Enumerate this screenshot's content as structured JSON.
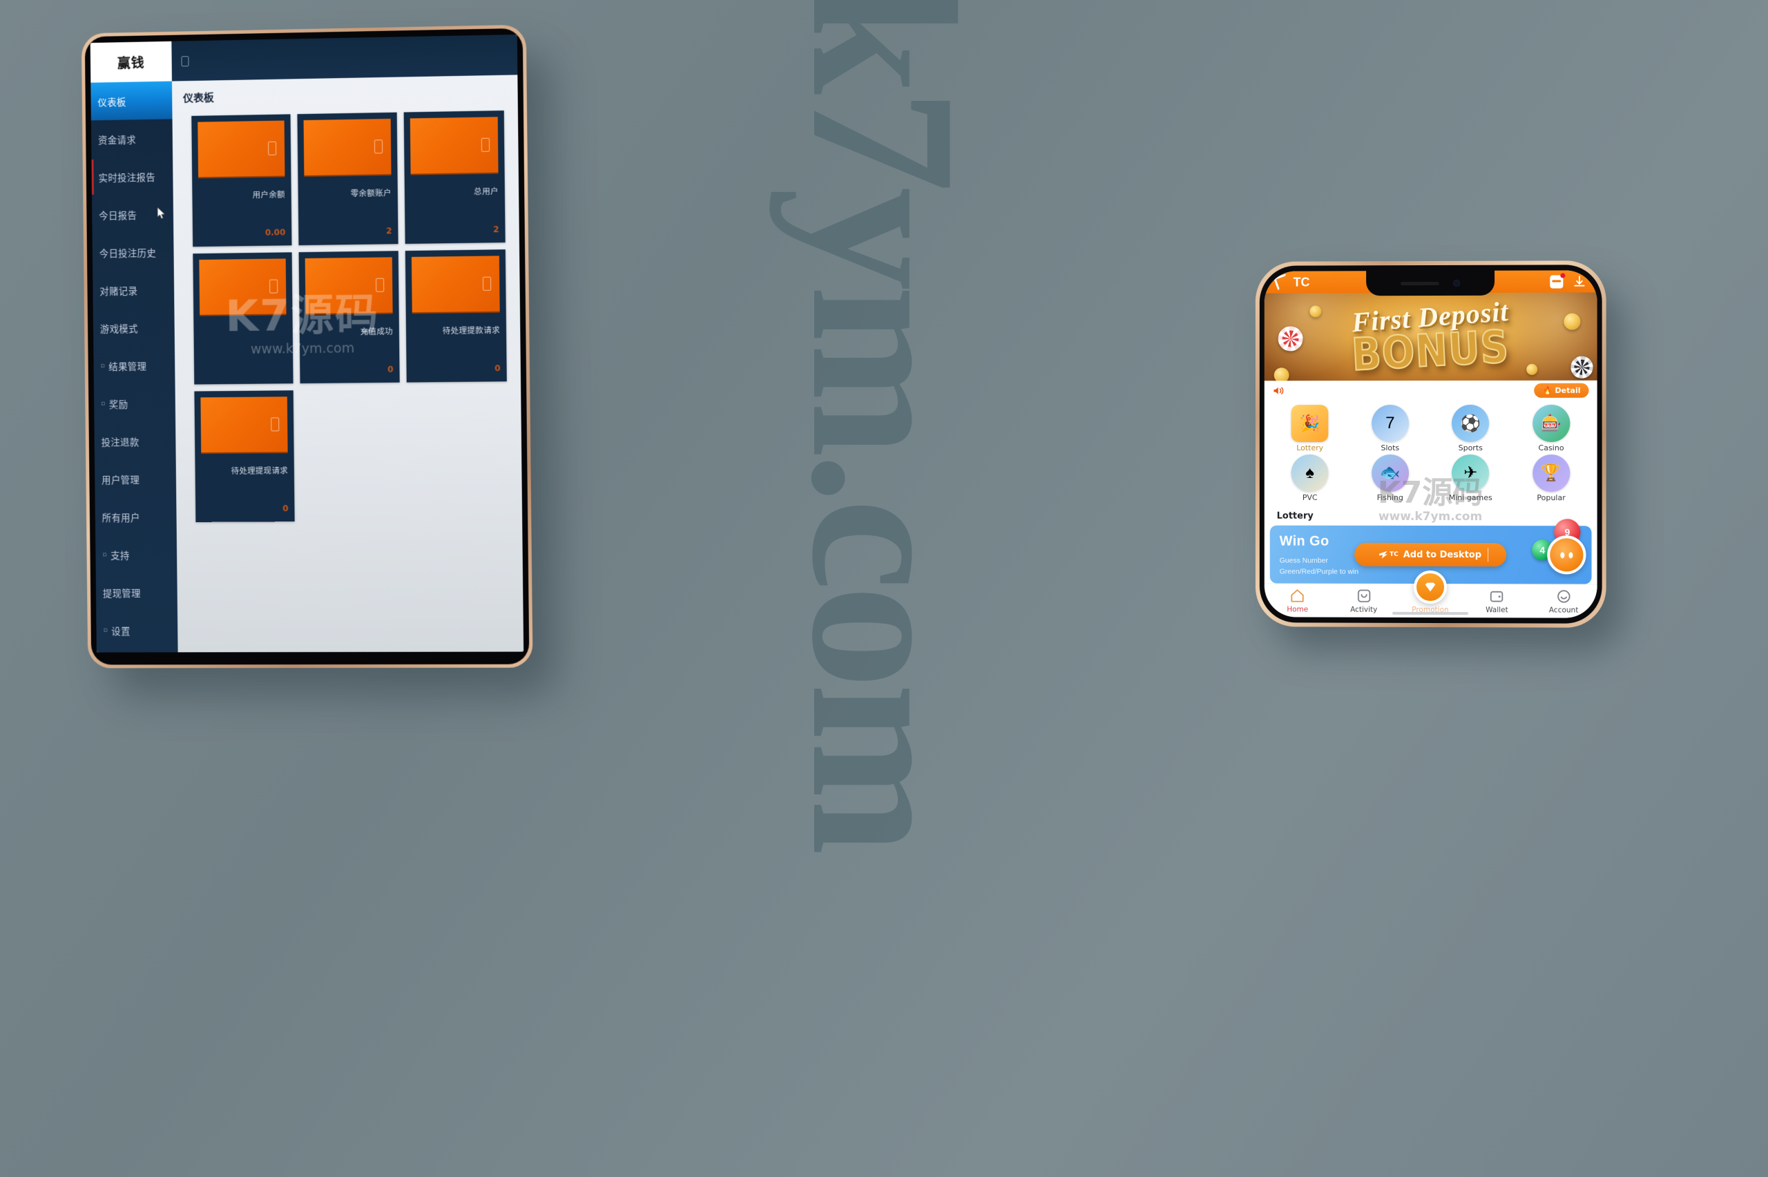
{
  "watermark": {
    "background_text": "k7ym.com",
    "tablet_overlay_big": "K7源码",
    "tablet_overlay_small": "www.k7ym.com",
    "phone_overlay_big": "K7源码",
    "phone_overlay_small": "www.k7ym.com",
    "color": "#4e646e"
  },
  "tablet": {
    "brand": "赢钱",
    "topbar": {
      "menu_icon": "menu-toggle-icon"
    },
    "page_title": "仪表板",
    "sidebar": {
      "items": [
        {
          "label": "仪表板",
          "active": true,
          "caret": "",
          "mark": false
        },
        {
          "label": "资金请求",
          "active": false,
          "caret": "",
          "mark": false
        },
        {
          "label": "实时投注报告",
          "active": false,
          "caret": "",
          "mark": true
        },
        {
          "label": "今日报告",
          "active": false,
          "caret": "",
          "mark": false
        },
        {
          "label": "今日投注历史",
          "active": false,
          "caret": "",
          "mark": false
        },
        {
          "label": "对赌记录",
          "active": false,
          "caret": "",
          "mark": false
        },
        {
          "label": "游戏模式",
          "active": false,
          "caret": "",
          "mark": false
        },
        {
          "label": "结果管理",
          "active": false,
          "caret": "▫",
          "mark": false
        },
        {
          "label": "奖励",
          "active": false,
          "caret": "▫",
          "mark": false
        },
        {
          "label": "投注退款",
          "active": false,
          "caret": "",
          "mark": false
        },
        {
          "label": "用户管理",
          "active": false,
          "caret": "",
          "mark": false
        },
        {
          "label": "所有用户",
          "active": false,
          "caret": "",
          "mark": false
        },
        {
          "label": "支持",
          "active": false,
          "caret": "▫",
          "mark": false
        },
        {
          "label": "提现管理",
          "active": false,
          "caret": "",
          "mark": false
        },
        {
          "label": "设置",
          "active": false,
          "caret": "▫",
          "mark": false
        }
      ]
    },
    "cards": [
      {
        "label": "用户余额",
        "value": "0.00",
        "icon": "wallet-icon"
      },
      {
        "label": "零余额账户",
        "value": "2",
        "icon": "account-icon"
      },
      {
        "label": "总用户",
        "value": "2",
        "icon": "users-icon"
      },
      {
        "label": "",
        "value": "",
        "icon": "chart-icon"
      },
      {
        "label": "充值成功",
        "value": "0",
        "icon": "deposit-icon"
      },
      {
        "label": "待处理提款请求",
        "value": "0",
        "icon": "pending-icon"
      },
      {
        "label": "待处理提现请求",
        "value": "0",
        "icon": "withdraw-icon"
      }
    ]
  },
  "phone": {
    "header": {
      "brand": "TC",
      "chat_icon": "chat-bubble-icon",
      "download_icon": "download-icon"
    },
    "banner": {
      "line1": "First Deposit",
      "line2": "BONUS"
    },
    "detail_bar": {
      "speaker_icon": "speaker-icon",
      "detail_label": "Detail",
      "flame_icon": "flame-icon"
    },
    "games": [
      {
        "label": "Lottery",
        "icon": "lottery-icon",
        "accent": true
      },
      {
        "label": "Slots",
        "icon": "slots-icon",
        "accent": false
      },
      {
        "label": "Sports",
        "icon": "sports-icon",
        "accent": false
      },
      {
        "label": "Casino",
        "icon": "casino-icon",
        "accent": false
      },
      {
        "label": "PVC",
        "icon": "cards-icon",
        "accent": false
      },
      {
        "label": "Fishing",
        "icon": "fishing-icon",
        "accent": false
      },
      {
        "label": "Mini games",
        "icon": "minigames-icon",
        "accent": false
      },
      {
        "label": "Popular",
        "icon": "trophy-icon",
        "accent": false
      }
    ],
    "section_title": "Lottery",
    "promo": {
      "title": "Win Go",
      "subtitle_line1": "Guess Number",
      "subtitle_line2": "Green/Red/Purple to win",
      "ball_red": "9",
      "ball_green": "4"
    },
    "add_to_desktop": {
      "brand_tag": "TC",
      "label": "Add to Desktop"
    },
    "tabs": [
      {
        "label": "Home",
        "icon": "home-icon",
        "state": "active"
      },
      {
        "label": "Activity",
        "icon": "activity-icon",
        "state": "normal"
      },
      {
        "label": "Promotion",
        "icon": "promotion-icon",
        "state": "muted"
      },
      {
        "label": "Wallet",
        "icon": "wallet-icon",
        "state": "normal"
      },
      {
        "label": "Account",
        "icon": "account-icon",
        "state": "normal"
      }
    ],
    "fab": {
      "icon": "diamond-icon"
    }
  }
}
